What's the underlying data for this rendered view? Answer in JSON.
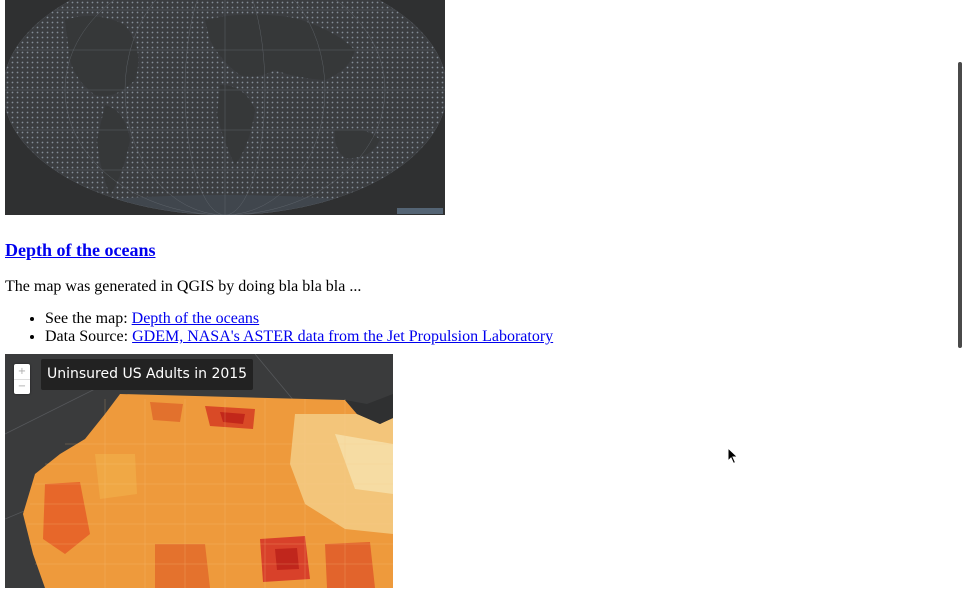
{
  "post": {
    "title": "Depth of the oceans",
    "description": "The map was generated in QGIS by doing bla bla bla ...",
    "see_map_label": "See the map:",
    "see_map_link": "Depth of the oceans",
    "data_source_label": "Data Source:",
    "data_source_link": "GDEM, NASA's ASTER data from the Jet Propulsion Laboratory"
  },
  "us_map": {
    "title": "Uninsured US Adults in 2015",
    "zoom_in": "+",
    "zoom_out": "−"
  },
  "icons": {
    "cursor": "arrow-cursor-icon"
  },
  "colors": {
    "link": "#0000ee",
    "map_background": "#2f3031",
    "choropleth_high": "#d7301f",
    "choropleth_mid": "#ef8a2c",
    "choropleth_low": "#f5d58a"
  }
}
